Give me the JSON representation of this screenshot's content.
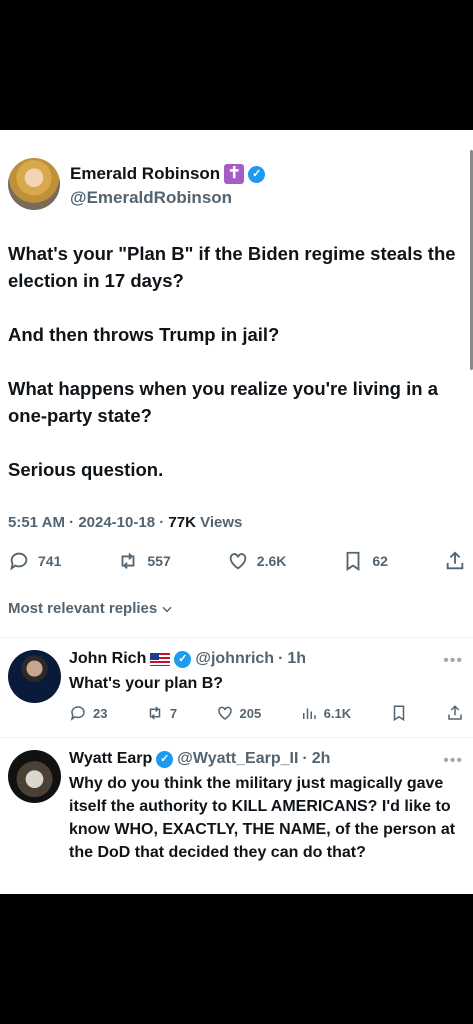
{
  "tweet": {
    "author_name": "Emerald Robinson",
    "name_emoji": "✝",
    "handle": "@EmeraldRobinson",
    "paragraphs": [
      "What's your \"Plan B\" if the Biden regime steals the election in 17 days?",
      "And then throws Trump in jail?",
      "What happens when you realize you're living in a one-party state?",
      "Serious question."
    ],
    "time": "5:51 AM",
    "date": "2024-10-18",
    "views_count": "77K",
    "views_label": "Views",
    "replies": "741",
    "reposts": "557",
    "likes": "2.6K",
    "bookmarks": "62"
  },
  "sort_label": "Most relevant replies",
  "replies": [
    {
      "name": "John Rich",
      "handle": "@johnrich",
      "time": "1h",
      "text": "What's your plan B?",
      "replies": "23",
      "reposts": "7",
      "likes": "205",
      "views": "6.1K"
    },
    {
      "name": "Wyatt Earp",
      "handle": "@Wyatt_Earp_II",
      "time": "2h",
      "text": "Why do you think the military just magically gave itself the authority to KILL AMERICANS? I'd like to know WHO, EXACTLY, THE NAME, of the person at the DoD that decided they can do that?"
    }
  ],
  "colors": {
    "verified": "#1d9bf0",
    "secondary_text": "#536471",
    "badge_purple": "#a45cc6"
  }
}
